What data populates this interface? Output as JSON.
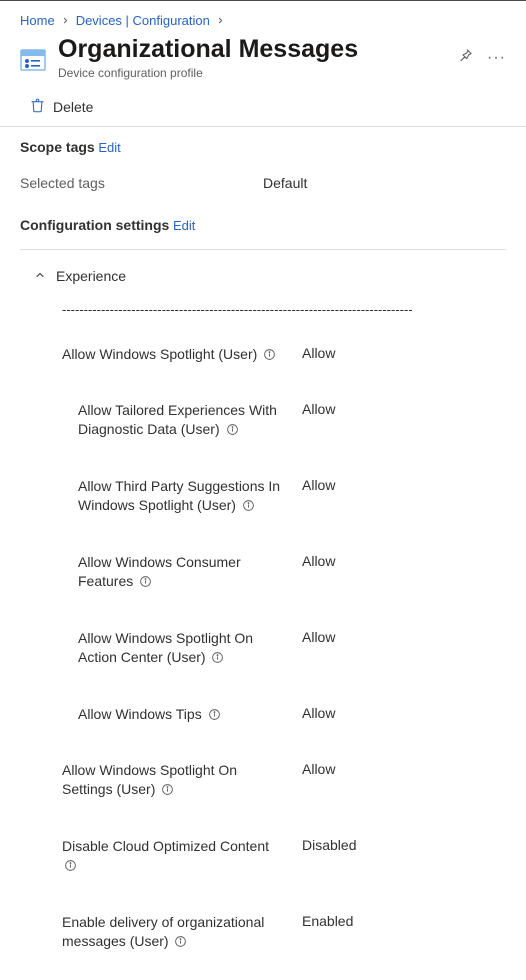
{
  "breadcrumb": {
    "home": "Home",
    "devices": "Devices | Configuration"
  },
  "header": {
    "title": "Organizational Messages",
    "subtitle": "Device configuration profile"
  },
  "toolbar": {
    "delete": "Delete"
  },
  "scope": {
    "title": "Scope tags",
    "edit": "Edit",
    "selected_label": "Selected tags",
    "selected_value": "Default"
  },
  "config": {
    "title": "Configuration settings",
    "edit": "Edit"
  },
  "group": {
    "name": "Experience"
  },
  "settings": [
    {
      "label": "Allow Windows Spotlight (User)",
      "value": "Allow",
      "indent": 0
    },
    {
      "label": "Allow Tailored Experiences With Diagnostic Data (User)",
      "value": "Allow",
      "indent": 1
    },
    {
      "label": "Allow Third Party Suggestions In Windows Spotlight (User)",
      "value": "Allow",
      "indent": 1
    },
    {
      "label": "Allow Windows Consumer Features",
      "value": "Allow",
      "indent": 1
    },
    {
      "label": "Allow Windows Spotlight On Action Center (User)",
      "value": "Allow",
      "indent": 1
    },
    {
      "label": "Allow Windows Tips",
      "value": "Allow",
      "indent": 1
    },
    {
      "label": "Allow Windows Spotlight On Settings (User)",
      "value": "Allow",
      "indent": 0
    },
    {
      "label": "Disable Cloud Optimized Content",
      "value": "Disabled",
      "indent": 0
    },
    {
      "label": "Enable delivery of organizational messages (User)",
      "value": "Enabled",
      "indent": 0
    }
  ]
}
